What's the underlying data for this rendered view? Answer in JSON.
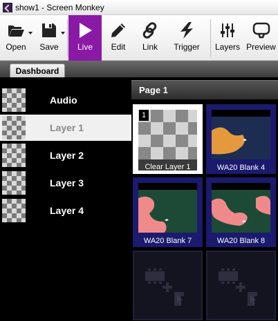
{
  "window": {
    "title": "show1 - Screen Monkey"
  },
  "toolbar": {
    "open": "Open",
    "save": "Save",
    "live": "Live",
    "edit": "Edit",
    "link": "Link",
    "trigger": "Trigger",
    "layers": "Layers",
    "preview": "Preview",
    "active_color": "#8a1aa6"
  },
  "tabs": {
    "dashboard": "Dashboard"
  },
  "layers": [
    {
      "label": "Audio"
    },
    {
      "label": "Layer 1",
      "selected": true
    },
    {
      "label": "Layer 2"
    },
    {
      "label": "Layer 3"
    },
    {
      "label": "Layer 4"
    }
  ],
  "page": {
    "title": "Page 1"
  },
  "tiles": [
    {
      "label": "Clear Layer 1",
      "number": "1",
      "kind": "clear"
    },
    {
      "label": "WA20 Blank 4",
      "kind": "media",
      "color": "#e49a3c"
    },
    {
      "label": "WA20 Blank 7",
      "kind": "media",
      "color": "#f08a8a"
    },
    {
      "label": "WA20 Blank 8",
      "kind": "media",
      "color": "#f08a8a"
    },
    {
      "kind": "empty"
    },
    {
      "kind": "empty"
    }
  ]
}
